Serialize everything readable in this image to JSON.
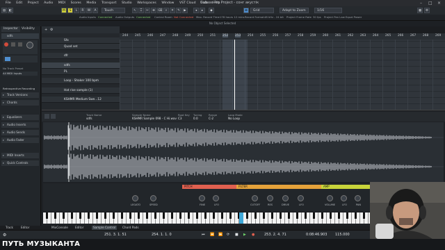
{
  "window": {
    "title": "Cubase Pro Project - сонг акустік"
  },
  "menu": [
    "File",
    "Edit",
    "Project",
    "Audio",
    "MIDI",
    "Scores",
    "Media",
    "Transport",
    "Studio",
    "Workspaces",
    "Window",
    "VST Cloud",
    "Hub",
    "Help"
  ],
  "toolbar": {
    "mode_buttons": [
      "M",
      "S",
      "L",
      "R",
      "W",
      "A"
    ],
    "touch_mode": "Touch",
    "snap_mode": "Grid",
    "snap_type": "Adapt to Zoom",
    "quantize": "1/16"
  },
  "statusbar": {
    "audio_inputs": "Audio Inputs",
    "audio_inputs_state": "Connected",
    "audio_outputs": "Audio Outputs",
    "audio_outputs_state": "Connected",
    "control_room": "Control Room",
    "control_room_state": "Not Connected",
    "max_record_time": "Max. Record Time",
    "max_record_value": "178 hours 12 mins",
    "record_format": "Record Format",
    "record_format_value": "48 kHz - 24 bit",
    "frame_rate": "Project Frame Rate",
    "frame_rate_value": "30 fps",
    "pan_law": "Project Pan Law",
    "pan_law_value": "Equal Power"
  },
  "info_line": "No Object Selected",
  "inspector": {
    "tabs": [
      "Inspector",
      "Visibility"
    ],
    "track_name": "sdfs",
    "routing_in": "No Track Preset",
    "routing_out": "All MIDI Inputs",
    "sections": [
      "Track Versions",
      "Chords",
      "Equalizers",
      "Audio Inserts",
      "Audio Sends",
      "Audio Fader",
      "MIDI Inserts",
      "Quick Controls"
    ],
    "retrospective": "Retrospective Recording"
  },
  "tracks": [
    {
      "num": "",
      "name": "Sfx"
    },
    {
      "num": "",
      "name": "Quad set"
    },
    {
      "num": "",
      "name": "dfr"
    },
    {
      "num": "",
      "name": "sdfs"
    },
    {
      "num": "",
      "name": "PL"
    },
    {
      "num": "",
      "name": "Loop - Shaker 100 bpm"
    },
    {
      "num": "",
      "name": "Hat rise sample (1)"
    },
    {
      "num": "",
      "name": "KSHMR Medium Swe...12"
    }
  ],
  "ruler": [
    "244",
    "245",
    "246",
    "247",
    "248",
    "249",
    "250",
    "251",
    "252",
    "253",
    "254",
    "255",
    "256",
    "257",
    "258",
    "259",
    "260",
    "261",
    "262",
    "263",
    "264",
    "265",
    "266",
    "267",
    "268",
    "269"
  ],
  "sampler": {
    "name_label": "Sample Name",
    "name_value": "KSHMR Sample 098 - C Hi.wav",
    "fields": [
      {
        "label": "Track Name",
        "value": "sdfs"
      },
      {
        "label": "Root Key",
        "value": "C3"
      },
      {
        "label": "Tuning",
        "value": "0.0"
      },
      {
        "label": "Range",
        "value": "C-2"
      },
      {
        "label": "Loop Mode",
        "value": "No Loop"
      }
    ]
  },
  "param_sections": [
    {
      "title": "PITCH",
      "color": "#e0604f"
    },
    {
      "title": "FILTER",
      "color": "#e5a23a"
    },
    {
      "title": "AMP",
      "color": "#c8d43a"
    }
  ],
  "knob_labels": [
    "LEGATO",
    "SPEED",
    "FINE",
    "LFO",
    "CUTOFF",
    "RES",
    "DRIVE",
    "LFO",
    "VOLUME",
    "LFO",
    "PAN"
  ],
  "bottom_tabs": [
    "Track",
    "Editor",
    "MixConsole",
    "Editor",
    "Sample Control",
    "Chord Pads"
  ],
  "transport": {
    "left_position": "251. 3. 1.  51",
    "right_position": "254. 1. 1.  0",
    "cycle_start": "253. 2. 4. 71",
    "time": "0:08:46.903",
    "tempo": "115.000"
  },
  "footer_caption": "ПУТЬ МУЗЫКАНТА"
}
